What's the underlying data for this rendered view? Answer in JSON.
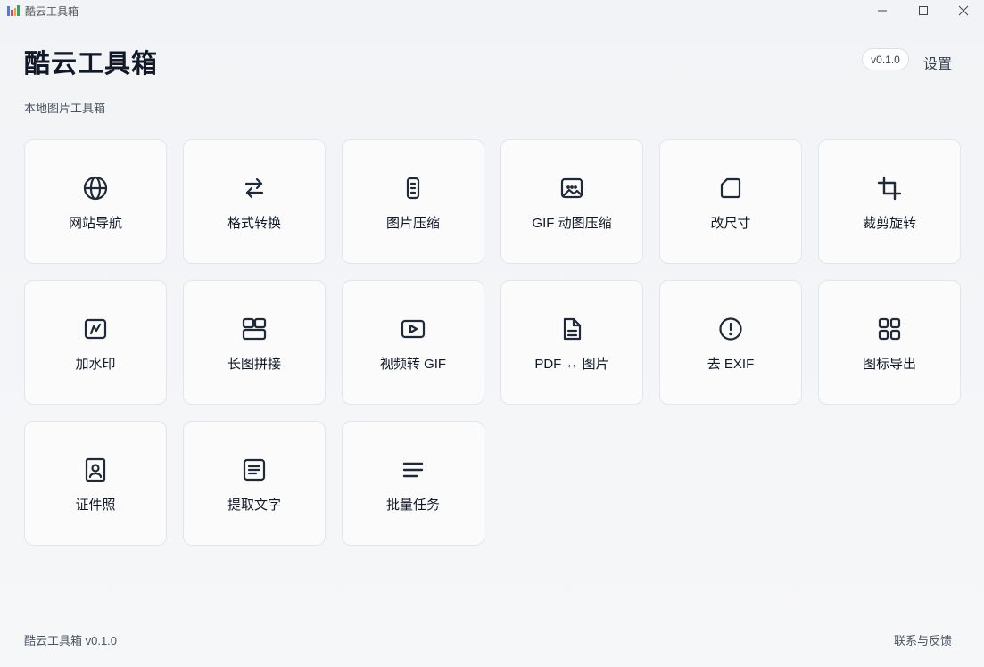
{
  "window": {
    "title": "酷云工具箱",
    "logo_text": "YII"
  },
  "header": {
    "title": "酷云工具箱",
    "subtitle": "本地图片工具箱",
    "version": "v0.1.0",
    "settings_label": "设置"
  },
  "tools": [
    {
      "label": "网站导航",
      "icon": "globe-icon"
    },
    {
      "label": "格式转换",
      "icon": "swap-arrows-icon"
    },
    {
      "label": "图片压缩",
      "icon": "zip-file-icon"
    },
    {
      "label": "GIF 动图压缩",
      "icon": "gif-image-icon"
    },
    {
      "label": "改尺寸",
      "icon": "resize-shape-icon"
    },
    {
      "label": "裁剪旋转",
      "icon": "crop-icon"
    },
    {
      "label": "加水印",
      "icon": "watermark-icon"
    },
    {
      "label": "长图拼接",
      "icon": "layout-stitch-icon"
    },
    {
      "label": "视频转 GIF",
      "icon": "video-play-icon"
    },
    {
      "label": "PDF ↔ 图片",
      "icon": "document-icon"
    },
    {
      "label": "去 EXIF",
      "icon": "alert-circle-icon"
    },
    {
      "label": "图标导出",
      "icon": "grid-icon"
    },
    {
      "label": "证件照",
      "icon": "id-photo-icon"
    },
    {
      "label": "提取文字",
      "icon": "text-extract-icon"
    },
    {
      "label": "批量任务",
      "icon": "list-icon"
    }
  ],
  "footer": {
    "app_version": "酷云工具箱 v0.1.0",
    "contact_label": "联系与反馈"
  }
}
